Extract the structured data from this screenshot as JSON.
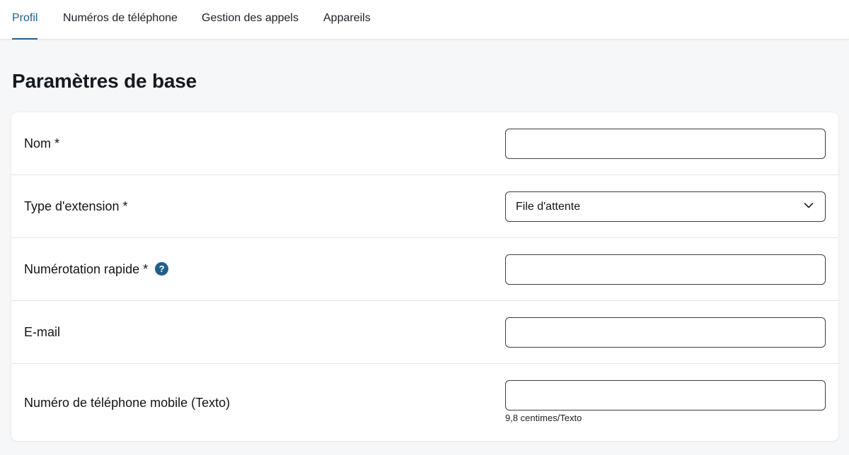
{
  "tabs": [
    {
      "label": "Profil",
      "active": true
    },
    {
      "label": "Numéros de téléphone",
      "active": false
    },
    {
      "label": "Gestion des appels",
      "active": false
    },
    {
      "label": "Appareils",
      "active": false
    }
  ],
  "page_title": "Paramètres de base",
  "form": {
    "name_label": "Nom *",
    "name_value": "",
    "extension_type_label": "Type d'extension *",
    "extension_type_value": "File d'attente",
    "speed_dial_label": "Numérotation rapide *",
    "speed_dial_value": "",
    "email_label": "E-mail",
    "email_value": "",
    "mobile_label": "Numéro de téléphone mobile (Texto)",
    "mobile_value": "",
    "mobile_hint": "9,8 centimes/Texto"
  },
  "icons": {
    "help": "help-icon",
    "chevron": "chevron-down-icon"
  },
  "colors": {
    "accent": "#1f5f8b",
    "page_background": "#f6f7f8",
    "card_background": "#ffffff"
  }
}
